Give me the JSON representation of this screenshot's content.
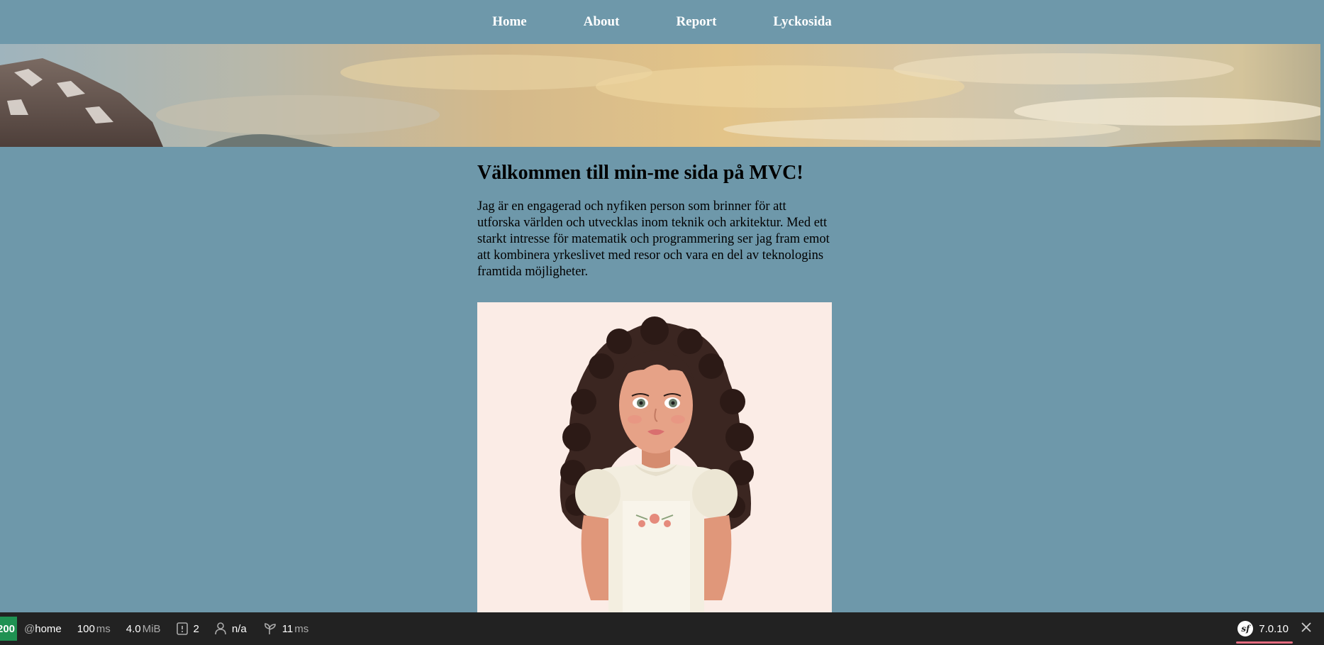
{
  "nav": {
    "items": [
      {
        "label": "Home"
      },
      {
        "label": "About"
      },
      {
        "label": "Report"
      },
      {
        "label": "Lyckosida"
      }
    ]
  },
  "main": {
    "heading": "Välkommen till min-me sida på MVC!",
    "intro": "Jag är en engagerad och nyfiken person som brinner för att utforska världen och utvecklas inom teknik och arkitektur. Med ett starkt intresse för matematik och programmering ser jag fram emot att kombinera yrkeslivet med resor och vara en del av teknologins framtida möjligheter."
  },
  "toolbar": {
    "status_code": "200",
    "route_prefix": "@",
    "route": "home",
    "time_value": "100",
    "time_unit": "ms",
    "memory_value": "4.0",
    "memory_unit": "MiB",
    "logs_count": "2",
    "user": "n/a",
    "twig_value": "11",
    "twig_unit": "ms",
    "symfony_version": "7.0.10",
    "colors": {
      "background": "#222222",
      "status": "#1f9152",
      "accent": "#e36b7f"
    },
    "icons": [
      "log-icon",
      "user-icon",
      "twig-icon",
      "symfony-logo-icon",
      "close-icon"
    ]
  }
}
